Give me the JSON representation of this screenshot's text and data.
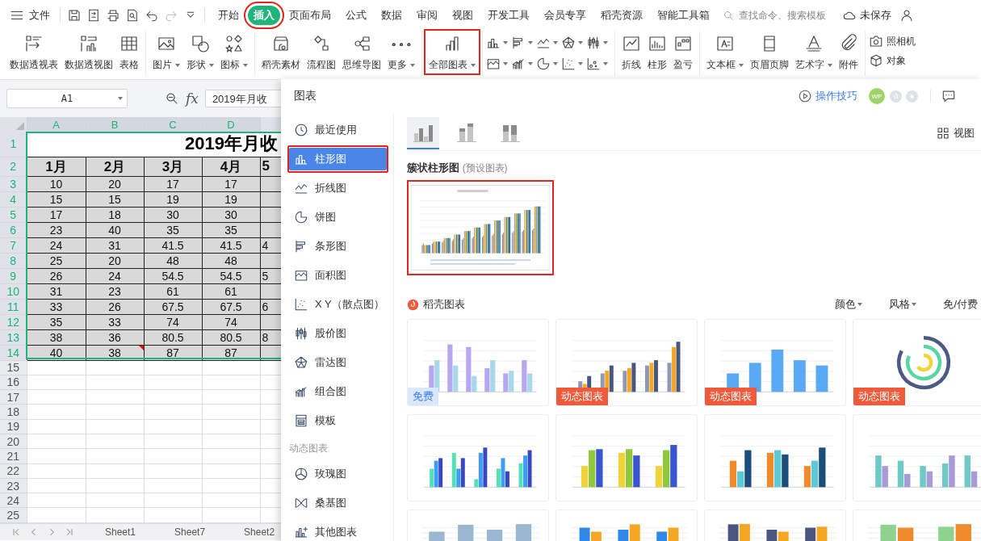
{
  "menu_bar": {
    "file": "文件",
    "tabs": [
      {
        "label": "开始",
        "selected": false,
        "highlighted": false
      },
      {
        "label": "插入",
        "selected": true,
        "highlighted": true
      },
      {
        "label": "页面布局",
        "selected": false,
        "highlighted": false
      },
      {
        "label": "公式",
        "selected": false,
        "highlighted": false
      },
      {
        "label": "数据",
        "selected": false,
        "highlighted": false
      },
      {
        "label": "审阅",
        "selected": false,
        "highlighted": false
      },
      {
        "label": "视图",
        "selected": false,
        "highlighted": false
      },
      {
        "label": "开发工具",
        "selected": false,
        "highlighted": false
      },
      {
        "label": "会员专享",
        "selected": false,
        "highlighted": false
      },
      {
        "label": "稻壳资源",
        "selected": false,
        "highlighted": false
      },
      {
        "label": "智能工具箱",
        "selected": false,
        "highlighted": false
      }
    ],
    "search": {
      "placeholder": "查找命令、搜索模板"
    },
    "save_status": "未保存"
  },
  "ribbon": {
    "groups": [
      {
        "kind": "large",
        "items": [
          {
            "label": "数据透视表",
            "dropdown": false,
            "highlighted": false
          },
          {
            "label": "数据透视图",
            "dropdown": false,
            "highlighted": false
          },
          {
            "label": "表格",
            "dropdown": false,
            "highlighted": false
          }
        ]
      },
      {
        "kind": "large",
        "items": [
          {
            "label": "图片",
            "dropdown": true,
            "highlighted": false
          },
          {
            "label": "形状",
            "dropdown": true,
            "highlighted": false
          },
          {
            "label": "图标",
            "dropdown": true,
            "highlighted": false
          }
        ]
      },
      {
        "kind": "large",
        "items": [
          {
            "label": "稻壳素材",
            "dropdown": false,
            "highlighted": false
          },
          {
            "label": "流程图",
            "dropdown": false,
            "highlighted": false
          },
          {
            "label": "思维导图",
            "dropdown": false,
            "highlighted": false
          },
          {
            "label": "更多",
            "dropdown": true,
            "highlighted": false
          }
        ]
      },
      {
        "kind": "large",
        "items": [
          {
            "label": "全部图表",
            "dropdown": true,
            "highlighted": true
          }
        ]
      },
      {
        "kind": "icon_grid"
      },
      {
        "kind": "large",
        "items": [
          {
            "label": "折线",
            "dropdown": false,
            "highlighted": false
          },
          {
            "label": "柱形",
            "dropdown": false,
            "highlighted": false
          },
          {
            "label": "盈亏",
            "dropdown": false,
            "highlighted": false
          }
        ]
      },
      {
        "kind": "large",
        "items": [
          {
            "label": "文本框",
            "dropdown": true,
            "highlighted": false
          },
          {
            "label": "页眉页脚",
            "dropdown": false,
            "highlighted": false
          },
          {
            "label": "艺术字",
            "dropdown": true,
            "highlighted": false
          },
          {
            "label": "附件",
            "dropdown": false,
            "highlighted": false
          }
        ]
      },
      {
        "kind": "small_stack",
        "items": [
          {
            "label": "照相机"
          },
          {
            "label": "对象"
          }
        ]
      }
    ]
  },
  "formula_bar": {
    "cell_ref": "A1",
    "function_label": "fx",
    "value": "2019年月收"
  },
  "sheet": {
    "columns": [
      {
        "label": "A",
        "selected": true
      },
      {
        "label": "B",
        "selected": true
      },
      {
        "label": "C",
        "selected": true
      },
      {
        "label": "D",
        "selected": true
      }
    ],
    "title_row": {
      "num": "1",
      "selected": true,
      "text": "2019年月收"
    },
    "header_row": {
      "num": "2",
      "selected": true,
      "cells": [
        "1月",
        "2月",
        "3月",
        "4月",
        "5"
      ]
    },
    "rows": [
      {
        "num": "3",
        "selected": true,
        "cells": [
          "10",
          "20",
          "17",
          "17"
        ]
      },
      {
        "num": "4",
        "selected": true,
        "cells": [
          "15",
          "15",
          "19",
          "19"
        ]
      },
      {
        "num": "5",
        "selected": true,
        "cells": [
          "17",
          "18",
          "30",
          "30"
        ]
      },
      {
        "num": "6",
        "selected": true,
        "cells": [
          "23",
          "40",
          "35",
          "35"
        ]
      },
      {
        "num": "7",
        "selected": true,
        "cells": [
          "24",
          "31",
          "41.5",
          "41.5",
          "4"
        ]
      },
      {
        "num": "8",
        "selected": true,
        "cells": [
          "25",
          "20",
          "48",
          "48"
        ]
      },
      {
        "num": "9",
        "selected": true,
        "cells": [
          "26",
          "24",
          "54.5",
          "54.5",
          "5"
        ]
      },
      {
        "num": "10",
        "selected": true,
        "cells": [
          "31",
          "23",
          "61",
          "61"
        ]
      },
      {
        "num": "11",
        "selected": true,
        "cells": [
          "33",
          "26",
          "67.5",
          "67.5",
          "6"
        ]
      },
      {
        "num": "12",
        "selected": true,
        "cells": [
          "35",
          "33",
          "74",
          "74"
        ]
      },
      {
        "num": "13",
        "selected": true,
        "cells": [
          "38",
          "36",
          "80.5",
          "80.5",
          "8"
        ]
      },
      {
        "num": "14",
        "selected": true,
        "cells": [
          "40",
          "38",
          "87",
          "87"
        ],
        "comments": [
          false,
          true,
          false,
          false
        ]
      }
    ],
    "empty_rows": [
      {
        "num": "15",
        "selected": false
      },
      {
        "num": "16",
        "selected": false
      },
      {
        "num": "17",
        "selected": false
      },
      {
        "num": "18",
        "selected": false
      },
      {
        "num": "19",
        "selected": false
      },
      {
        "num": "20",
        "selected": false
      },
      {
        "num": "21",
        "selected": false
      },
      {
        "num": "22",
        "selected": false
      },
      {
        "num": "23",
        "selected": false
      },
      {
        "num": "24",
        "selected": false
      },
      {
        "num": "25",
        "selected": false
      }
    ],
    "tabs": [
      "Sheet1",
      "Sheet7",
      "Sheet2"
    ]
  },
  "chart_dialog": {
    "title": "图表",
    "tips": "操作技巧",
    "avatar": "WP",
    "menu": [
      {
        "label": "最近使用",
        "selected": false,
        "highlighted": false
      },
      {
        "label": "柱形图",
        "selected": true,
        "highlighted": true
      },
      {
        "label": "折线图",
        "selected": false,
        "highlighted": false
      },
      {
        "label": "饼图",
        "selected": false,
        "highlighted": false
      },
      {
        "label": "条形图",
        "selected": false,
        "highlighted": false
      },
      {
        "label": "面积图",
        "selected": false,
        "highlighted": false
      },
      {
        "label": "X Y（散点图）",
        "selected": false,
        "highlighted": false
      },
      {
        "label": "股价图",
        "selected": false,
        "highlighted": false
      },
      {
        "label": "雷达图",
        "selected": false,
        "highlighted": false
      },
      {
        "label": "组合图",
        "selected": false,
        "highlighted": false
      },
      {
        "label": "模板",
        "selected": false,
        "highlighted": false
      }
    ],
    "section": "动态图表",
    "section_menu": [
      {
        "label": "玫瑰图",
        "selected": false,
        "highlighted": false
      },
      {
        "label": "桑基图",
        "selected": false,
        "highlighted": false
      },
      {
        "label": "其他图表",
        "selected": false,
        "highlighted": false
      }
    ],
    "subtypes": [
      {
        "kind": "clustered",
        "selected": true
      },
      {
        "kind": "stacked",
        "selected": false
      },
      {
        "kind": "percent",
        "selected": false
      }
    ],
    "view": "视图",
    "preset_title": "簇状柱形图",
    "preset_note": "(预设图表)",
    "preset_highlighted": true,
    "library_title": "稻壳图表",
    "filters": [
      "颜色",
      "风格",
      "免/付费"
    ],
    "templates": [
      {
        "kind": "column",
        "badge": {
          "kind": "free",
          "text": "免费"
        }
      },
      {
        "kind": "column",
        "badge": {
          "kind": "dynamic",
          "text": "动态图表"
        }
      },
      {
        "kind": "column",
        "badge": {
          "kind": "dynamic",
          "text": "动态图表"
        }
      },
      {
        "kind": "ring",
        "badge": {
          "kind": "dynamic",
          "text": "动态图表"
        }
      },
      {
        "kind": "column"
      },
      {
        "kind": "column"
      },
      {
        "kind": "column"
      },
      {
        "kind": "column"
      },
      {
        "kind": "column"
      },
      {
        "kind": "column"
      },
      {
        "kind": "column"
      },
      {
        "kind": "column"
      }
    ]
  }
}
